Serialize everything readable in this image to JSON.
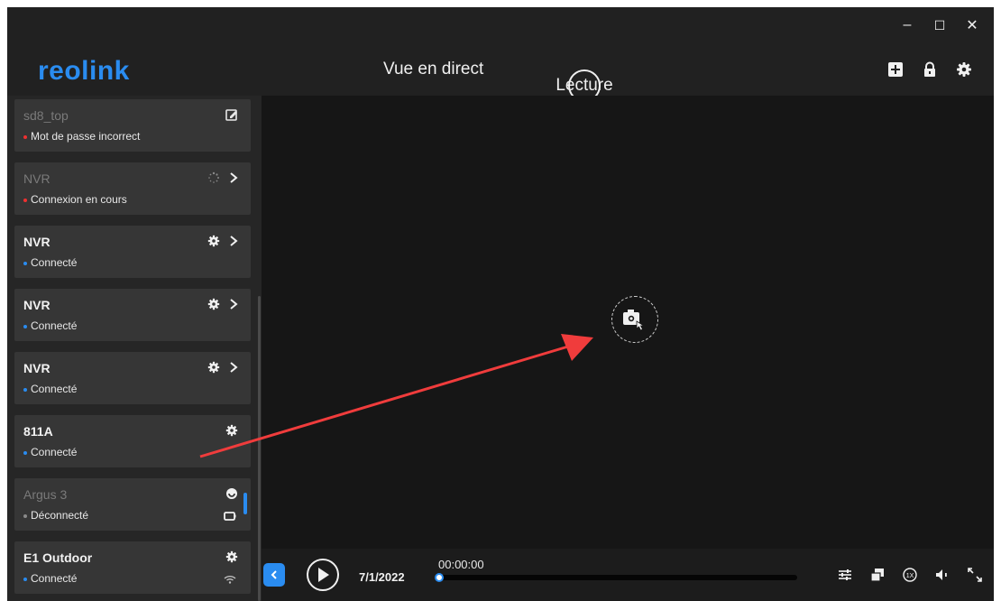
{
  "brand": {
    "logo": "reolink",
    "accent_color": "#2a8cf0"
  },
  "window_controls": {
    "minimize": "–",
    "maximize": "☐",
    "close": "✕"
  },
  "tabs": [
    {
      "label": "Vue en direct",
      "active": false
    },
    {
      "label": "Lecture",
      "active": true
    }
  ],
  "header_icons": [
    "add-icon",
    "lock-icon",
    "settings-icon"
  ],
  "devices": [
    {
      "name": "sd8_top",
      "status": "Mot de passe incorrect",
      "status_color": "#f03030",
      "dim": true,
      "icons": [
        "edit-icon"
      ]
    },
    {
      "name": "NVR",
      "status": "Connexion en cours",
      "status_color": "#f03030",
      "dim": true,
      "icons": [
        "loading-icon",
        "chevron-right-icon"
      ]
    },
    {
      "name": "NVR",
      "status": "Connecté",
      "status_color": "#2a8cf0",
      "dim": false,
      "icons": [
        "gear-icon",
        "chevron-right-icon"
      ]
    },
    {
      "name": "NVR",
      "status": "Connecté",
      "status_color": "#2a8cf0",
      "dim": false,
      "icons": [
        "gear-icon",
        "chevron-right-icon"
      ]
    },
    {
      "name": "NVR",
      "status": "Connecté",
      "status_color": "#2a8cf0",
      "dim": false,
      "icons": [
        "gear-icon",
        "chevron-right-icon"
      ]
    },
    {
      "name": "811A",
      "status": "Connecté",
      "status_color": "#2a8cf0",
      "dim": false,
      "icons": [
        "gear-icon"
      ]
    },
    {
      "name": "Argus 3",
      "status": "Déconnecté",
      "status_color": "#8a8a8a",
      "dim": true,
      "icons": [
        "sleep-icon",
        "battery-icon"
      ]
    },
    {
      "name": "E1 Outdoor",
      "status": "Connecté",
      "status_color": "#2a8cf0",
      "dim": false,
      "icons": [
        "gear-icon",
        "wifi-icon"
      ]
    }
  ],
  "playback": {
    "date": "7/1/2022",
    "time": "00:00:00",
    "progress": 0,
    "controls": [
      "settings-sliders-icon",
      "multi-window-icon",
      "speed-1x-icon",
      "volume-icon",
      "fullscreen-icon"
    ]
  },
  "snapshot_icon": "snapshot-icon"
}
